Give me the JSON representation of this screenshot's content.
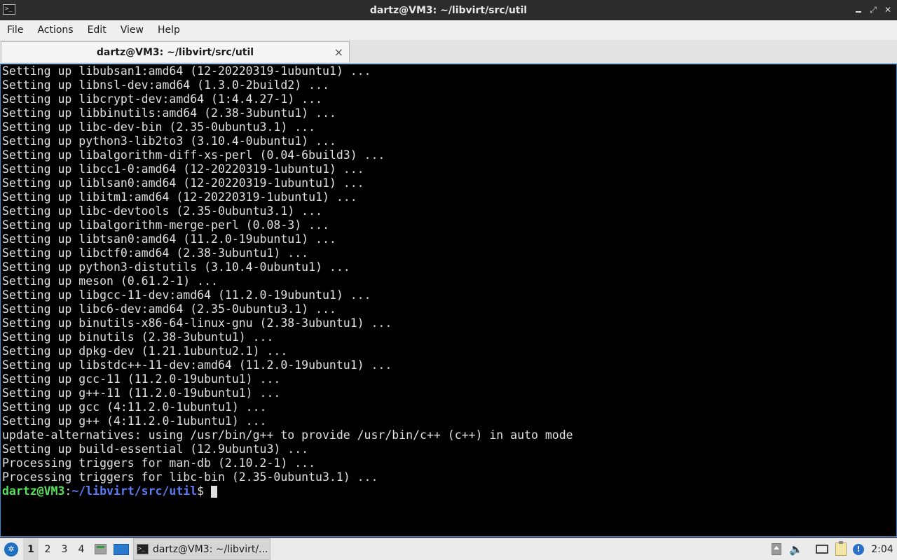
{
  "window": {
    "title": "dartz@VM3: ~/libvirt/src/util",
    "app_icon": "terminal-icon"
  },
  "menu": {
    "items": [
      "File",
      "Actions",
      "Edit",
      "View",
      "Help"
    ]
  },
  "tabs": [
    {
      "label": "dartz@VM3: ~/libvirt/src/util",
      "close": "×"
    }
  ],
  "terminal": {
    "lines": [
      "Setting up libubsan1:amd64 (12-20220319-1ubuntu1) ...",
      "Setting up libnsl-dev:amd64 (1.3.0-2build2) ...",
      "Setting up libcrypt-dev:amd64 (1:4.4.27-1) ...",
      "Setting up libbinutils:amd64 (2.38-3ubuntu1) ...",
      "Setting up libc-dev-bin (2.35-0ubuntu3.1) ...",
      "Setting up python3-lib2to3 (3.10.4-0ubuntu1) ...",
      "Setting up libalgorithm-diff-xs-perl (0.04-6build3) ...",
      "Setting up libcc1-0:amd64 (12-20220319-1ubuntu1) ...",
      "Setting up liblsan0:amd64 (12-20220319-1ubuntu1) ...",
      "Setting up libitm1:amd64 (12-20220319-1ubuntu1) ...",
      "Setting up libc-devtools (2.35-0ubuntu3.1) ...",
      "Setting up libalgorithm-merge-perl (0.08-3) ...",
      "Setting up libtsan0:amd64 (11.2.0-19ubuntu1) ...",
      "Setting up libctf0:amd64 (2.38-3ubuntu1) ...",
      "Setting up python3-distutils (3.10.4-0ubuntu1) ...",
      "Setting up meson (0.61.2-1) ...",
      "Setting up libgcc-11-dev:amd64 (11.2.0-19ubuntu1) ...",
      "Setting up libc6-dev:amd64 (2.35-0ubuntu3.1) ...",
      "Setting up binutils-x86-64-linux-gnu (2.38-3ubuntu1) ...",
      "Setting up binutils (2.38-3ubuntu1) ...",
      "Setting up dpkg-dev (1.21.1ubuntu2.1) ...",
      "Setting up libstdc++-11-dev:amd64 (11.2.0-19ubuntu1) ...",
      "Setting up gcc-11 (11.2.0-19ubuntu1) ...",
      "Setting up g++-11 (11.2.0-19ubuntu1) ...",
      "Setting up gcc (4:11.2.0-1ubuntu1) ...",
      "Setting up g++ (4:11.2.0-1ubuntu1) ...",
      "update-alternatives: using /usr/bin/g++ to provide /usr/bin/c++ (c++) in auto mode",
      "Setting up build-essential (12.9ubuntu3) ...",
      "Processing triggers for man-db (2.10.2-1) ...",
      "Processing triggers for libc-bin (2.35-0ubuntu3.1) ..."
    ],
    "prompt": {
      "user": "dartz@VM3",
      "colon": ":",
      "path": "~/libvirt/src/util",
      "dollar": "$"
    }
  },
  "taskbar": {
    "workspaces": [
      "1",
      "2",
      "3",
      "4"
    ],
    "active_workspace": "1",
    "task_label": "dartz@VM3: ~/libvirt/...",
    "clock": "2:04",
    "update_badge": "!",
    "colors": {
      "prompt_user": "#55e05a",
      "prompt_path": "#5c7cf5",
      "accent": "#3b8ad8"
    }
  }
}
